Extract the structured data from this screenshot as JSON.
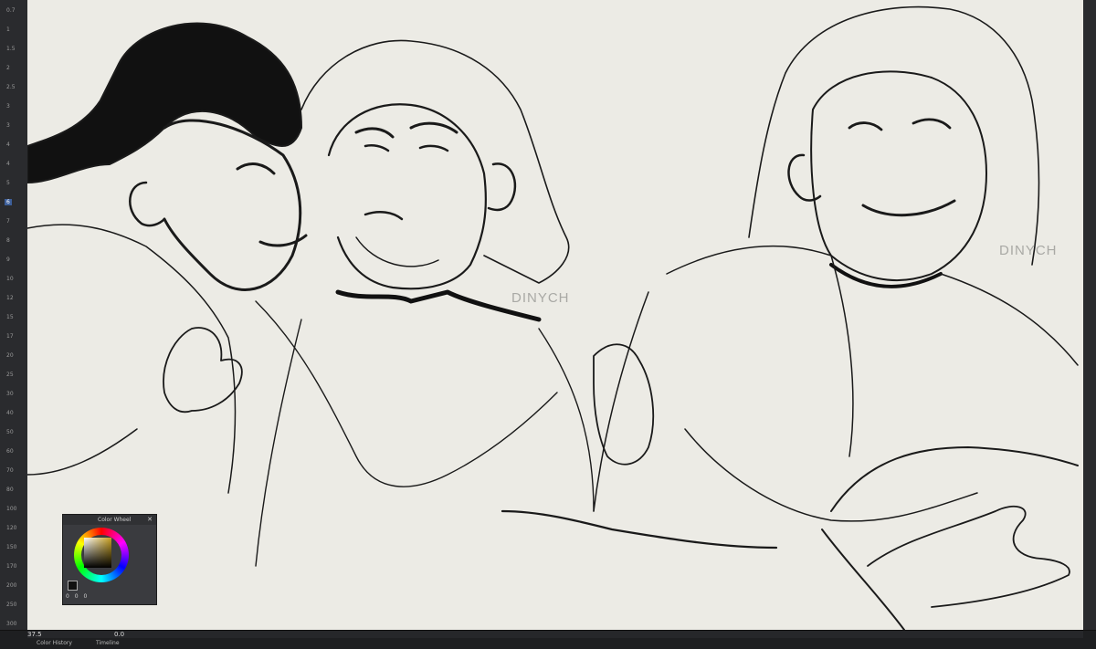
{
  "ruler": {
    "ticks": [
      "0.7",
      "1",
      "1.5",
      "2",
      "2.5",
      "3",
      "3",
      "4",
      "4",
      "5",
      "6",
      "7",
      "8",
      "9",
      "10",
      "12",
      "15",
      "17",
      "20",
      "25",
      "30",
      "40",
      "50",
      "60",
      "70",
      "80",
      "100",
      "120",
      "150",
      "170",
      "200",
      "250",
      "300"
    ]
  },
  "canvas": {
    "signatures": [
      "DINYCH",
      "DINYCH"
    ]
  },
  "color_wheel": {
    "title": "Color Wheel",
    "close": "✕",
    "values": [
      "0",
      "0",
      "0"
    ]
  },
  "status_bar": {
    "zoom": "37.5",
    "angle": "0.0",
    "tabs": [
      "Color History",
      "Timeline"
    ]
  },
  "colors": {
    "canvas": "#ecebe5",
    "panel": "#2a2b2e",
    "accent": "#3d5f9a"
  }
}
